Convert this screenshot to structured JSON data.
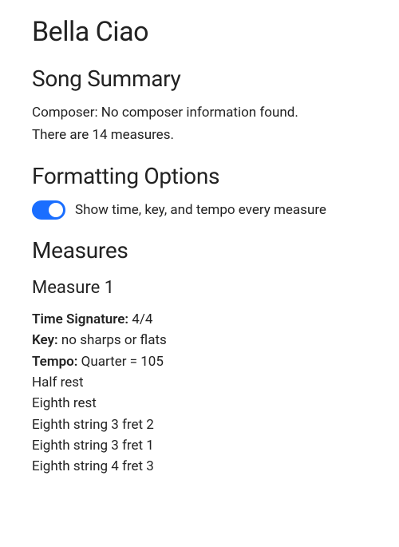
{
  "title": "Bella Ciao",
  "summary": {
    "heading": "Song Summary",
    "composer_line": "Composer: No composer information found.",
    "measures_line": "There are 14 measures."
  },
  "formatting": {
    "heading": "Formatting Options",
    "toggle_label": "Show time, key, and tempo every measure"
  },
  "measures": {
    "heading": "Measures",
    "m1": {
      "heading": "Measure 1",
      "time_sig_label": "Time Signature: ",
      "time_sig_value": "4/4",
      "key_label": "Key: ",
      "key_value": "no sharps or flats",
      "tempo_label": "Tempo: ",
      "tempo_value": "Quarter = 105",
      "notes": {
        "n0": "Half rest",
        "n1": "Eighth rest",
        "n2": "Eighth string 3 fret 2",
        "n3": "Eighth string 3 fret 1",
        "n4": "Eighth string 4 fret 3"
      }
    }
  }
}
